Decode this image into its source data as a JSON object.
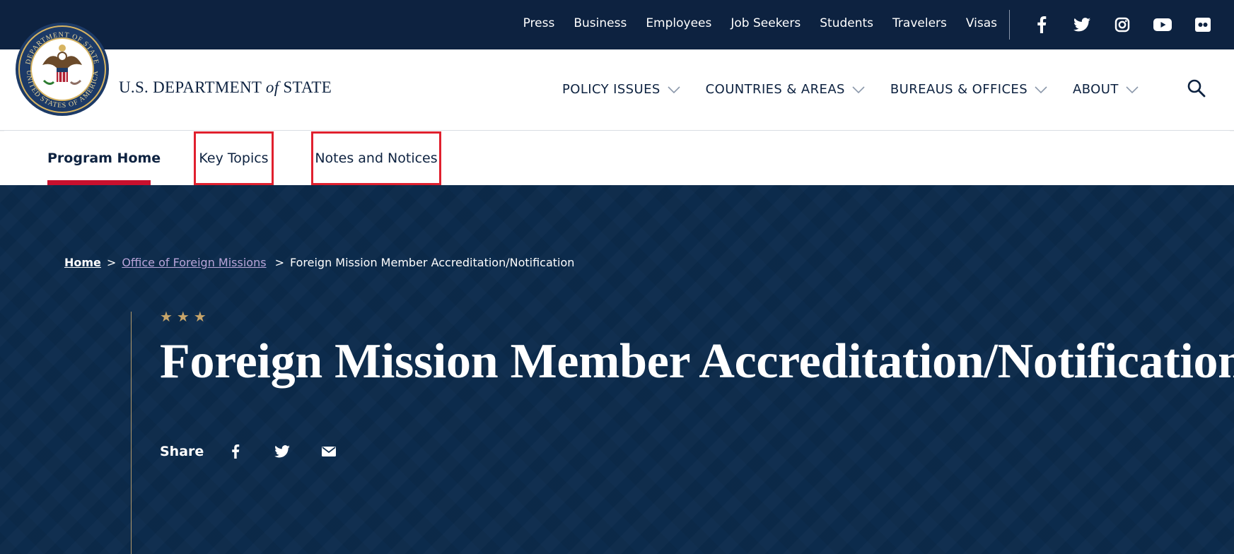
{
  "utility_nav": [
    "Press",
    "Business",
    "Employees",
    "Job Seekers",
    "Students",
    "Travelers",
    "Visas"
  ],
  "social_top": [
    "facebook-icon",
    "twitter-icon",
    "instagram-icon",
    "youtube-icon",
    "flickr-icon"
  ],
  "site": {
    "title_prefix": "U.S. DEPARTMENT ",
    "title_of": "of",
    "title_suffix": " STATE",
    "seal_top_text": "DEPARTMENT OF STATE",
    "seal_bottom_text": "UNITED STATES OF AMERICA"
  },
  "main_nav": [
    "POLICY ISSUES",
    "COUNTRIES & AREAS",
    "BUREAUS & OFFICES",
    "ABOUT"
  ],
  "subnav": {
    "home": "Program Home",
    "key_topics": "Key Topics",
    "notes": "Notes and Notices"
  },
  "breadcrumb": {
    "home": "Home",
    "sep": ">",
    "office": "Office of Foreign Missions",
    "current": "Foreign Mission Member Accreditation/Notification"
  },
  "hero": {
    "stars": "★★★",
    "title": "Foreign Mission Member Accreditation/Notification",
    "share_label": "Share"
  },
  "colors": {
    "navy": "#0d2240",
    "hero_bg": "#0c2b4c",
    "accent_red": "#c8102e",
    "gold": "#c7a56a",
    "link_purple": "#b9a5d9"
  }
}
